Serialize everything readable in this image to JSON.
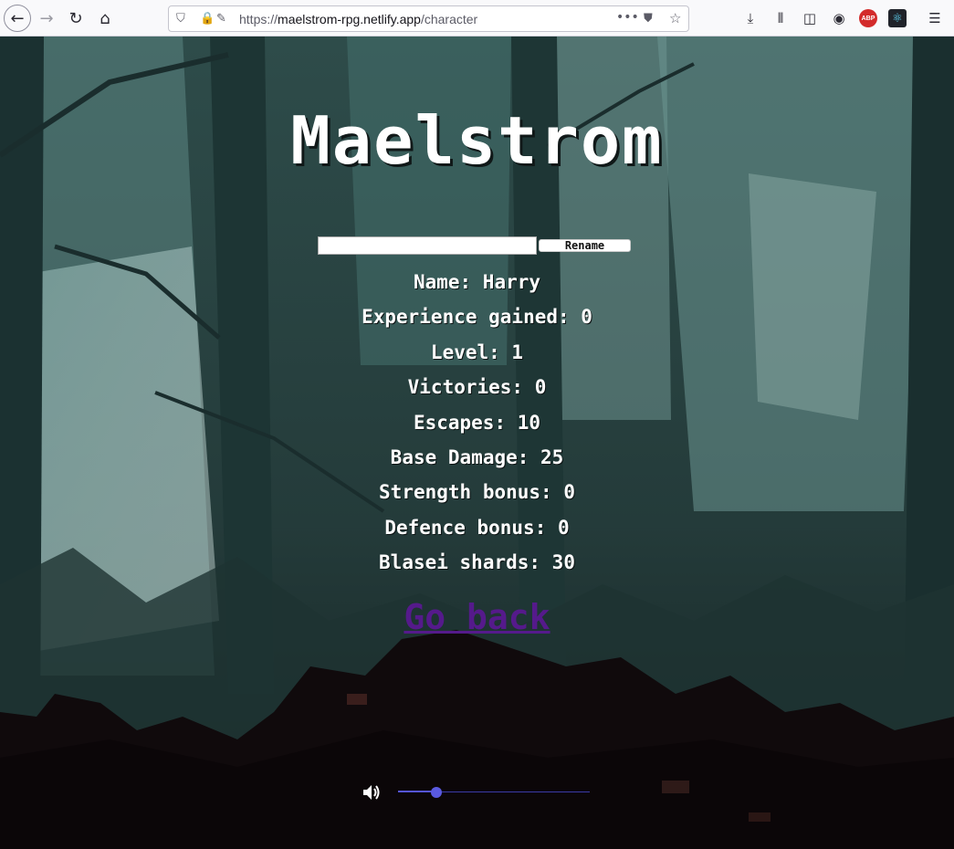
{
  "browser": {
    "url_prefix": "https://",
    "url_host": "maelstrom-rpg.netlify.app",
    "url_path": "/character",
    "abp_label": "ABP"
  },
  "page": {
    "title": "Maelstrom",
    "rename_value": "",
    "rename_button": "Rename",
    "stats": [
      "Name: Harry",
      "Experience gained: 0",
      "Level: 1",
      "Victories: 0",
      "Escapes: 10",
      "Base Damage: 25",
      "Strength bonus: 0",
      "Defence bonus: 0",
      "Blasei shards: 30"
    ],
    "go_back": "Go back",
    "volume_level": 0.2
  },
  "colors": {
    "link": "#551a8b",
    "slider": "#5a5ae0"
  }
}
